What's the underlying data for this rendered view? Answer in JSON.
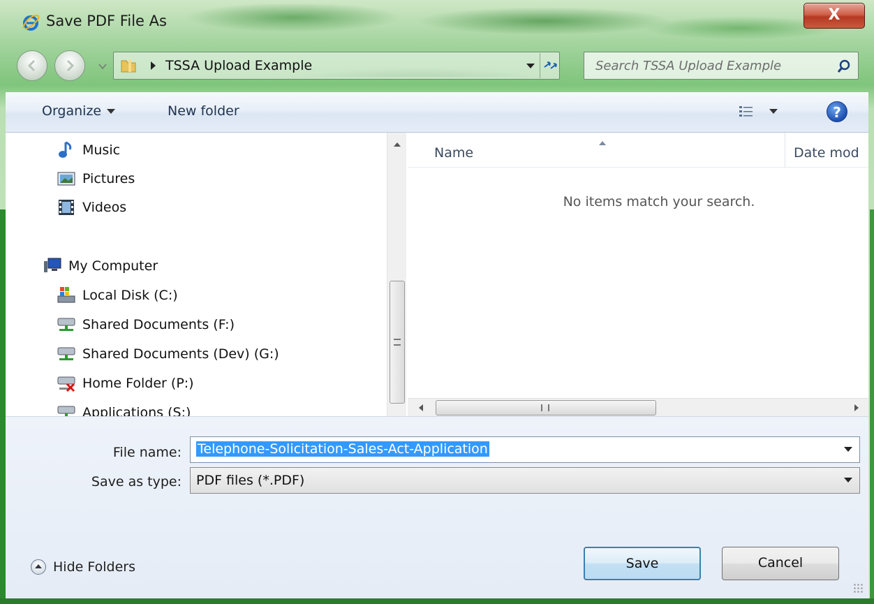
{
  "window": {
    "title": "Save PDF File As",
    "close_label": "X"
  },
  "address_bar": {
    "breadcrumb": "TSSA Upload Example"
  },
  "search": {
    "placeholder": "Search TSSA Upload Example"
  },
  "toolbar": {
    "organize_label": "Organize",
    "new_folder_label": "New folder",
    "help_label": "?"
  },
  "nav_tree": {
    "items": [
      {
        "label": "Music",
        "icon": "music-icon"
      },
      {
        "label": "Pictures",
        "icon": "pictures-icon"
      },
      {
        "label": "Videos",
        "icon": "videos-icon"
      },
      {
        "label": "My Computer",
        "icon": "computer-icon"
      },
      {
        "label": "Local Disk (C:)",
        "icon": "local-disk-icon"
      },
      {
        "label": "Shared Documents (F:)",
        "icon": "network-drive-icon"
      },
      {
        "label": "Shared Documents (Dev) (G:)",
        "icon": "network-drive-icon"
      },
      {
        "label": "Home Folder (P:)",
        "icon": "disconnected-drive-icon"
      },
      {
        "label": "Applications (S:)",
        "icon": "network-drive-icon"
      }
    ]
  },
  "file_list": {
    "columns": [
      "Name",
      "Date mod"
    ],
    "empty_message": "No items match your search."
  },
  "form": {
    "file_name_label": "File name:",
    "file_name_value": "Telephone-Solicitation-Sales-Act-Application",
    "save_type_label": "Save as type:",
    "save_type_value": "PDF files (*.PDF)"
  },
  "footer": {
    "hide_folders_label": "Hide Folders",
    "save_label": "Save",
    "cancel_label": "Cancel"
  },
  "colors": {
    "glass_green": "#7fc57c",
    "toolbar_blue": "#dce6f3",
    "selection": "#3399ff",
    "close_red": "#c9503a"
  }
}
